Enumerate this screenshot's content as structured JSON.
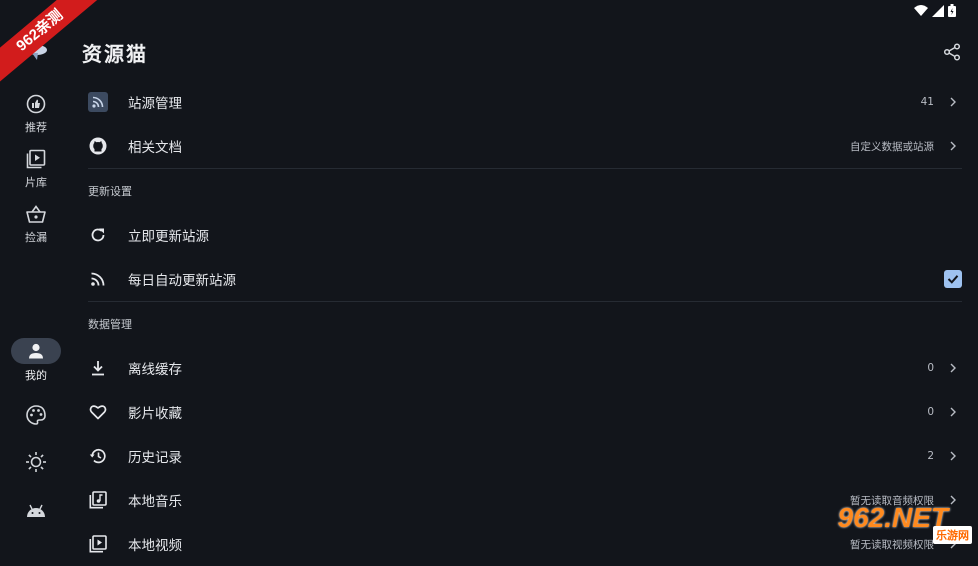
{
  "corner_badge": "962亲测",
  "app": {
    "title": "资源猫"
  },
  "rail": {
    "recommend": "推荐",
    "library": "片库",
    "pickup": "捡漏",
    "me": "我的"
  },
  "settings": {
    "source_manage": {
      "title": "站源管理",
      "summary": "41"
    },
    "docs": {
      "title": "相关文档",
      "summary": "自定义数据或站源"
    },
    "update_section": "更新设置",
    "update_now": {
      "title": "立即更新站源"
    },
    "auto_update": {
      "title": "每日自动更新站源",
      "checked": true
    },
    "data_section": "数据管理",
    "offline_cache": {
      "title": "离线缓存",
      "summary": "0"
    },
    "favorites": {
      "title": "影片收藏",
      "summary": "0"
    },
    "history": {
      "title": "历史记录",
      "summary": "2"
    },
    "local_music": {
      "title": "本地音乐",
      "summary": "暂无读取音频权限"
    },
    "local_video": {
      "title": "本地视频",
      "summary": "暂无读取视频权限"
    }
  },
  "watermark": {
    "logo": "962.NET",
    "sub": "乐游网"
  },
  "colors": {
    "background": "#12151b",
    "accent": "#9ec2f0",
    "badge": "#d21c1c"
  }
}
